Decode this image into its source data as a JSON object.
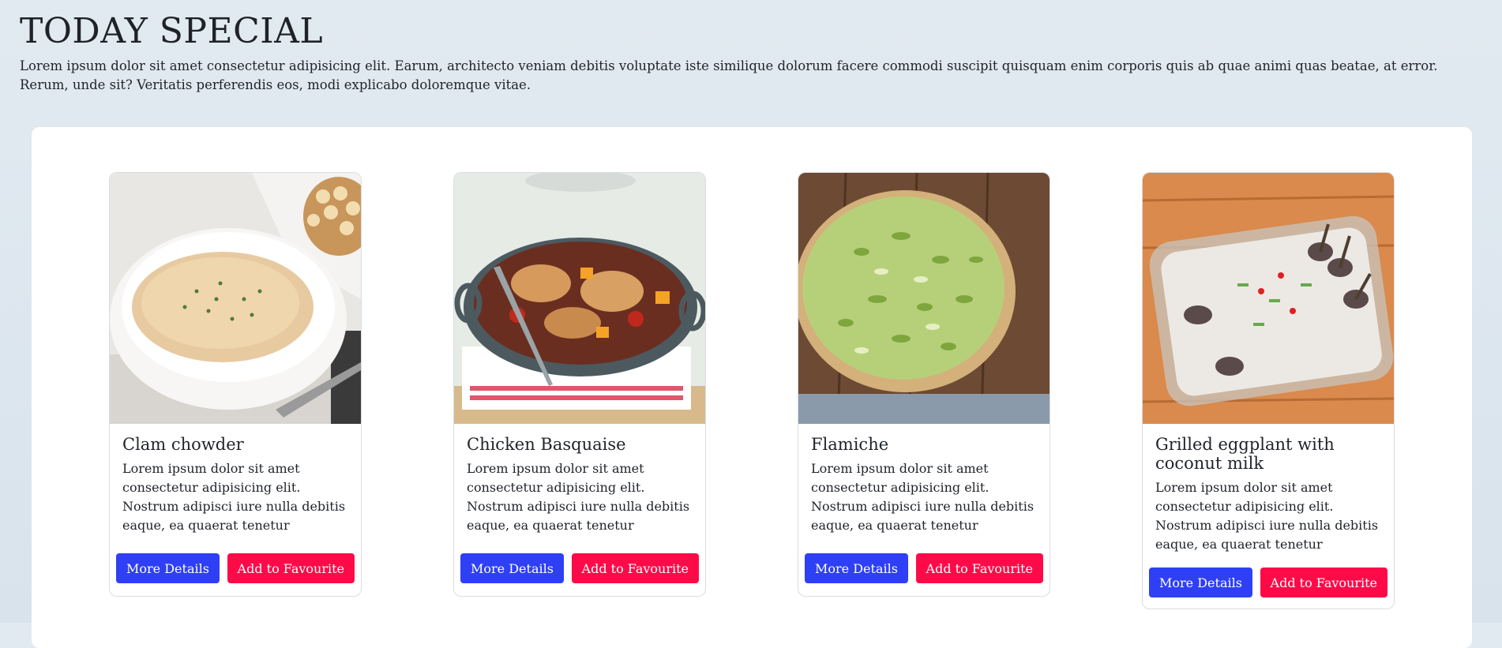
{
  "header": {
    "title": "TODAY SPECIAL",
    "intro": "Lorem ipsum dolor sit amet consectetur adipisicing elit. Earum, architecto veniam debitis voluptate iste similique dolorum facere commodi suscipit quisquam enim corporis quis ab quae animi quas beatae, at error. Rerum, unde sit? Veritatis perferendis eos, modi explicabo doloremque vitae."
  },
  "cards": [
    {
      "title": "Clam chowder",
      "text": "Lorem ipsum dolor sit amet consectetur adipisicing elit. Nostrum adipisci iure nulla debitis eaque, ea quaerat tenetur",
      "details_label": "More Details",
      "favourite_label": "Add to Favourite"
    },
    {
      "title": "Chicken Basquaise",
      "text": "Lorem ipsum dolor sit amet consectetur adipisicing elit. Nostrum adipisci iure nulla debitis eaque, ea quaerat tenetur",
      "details_label": "More Details",
      "favourite_label": "Add to Favourite"
    },
    {
      "title": "Flamiche",
      "text": "Lorem ipsum dolor sit amet consectetur adipisicing elit. Nostrum adipisci iure nulla debitis eaque, ea quaerat tenetur",
      "details_label": "More Details",
      "favourite_label": "Add to Favourite"
    },
    {
      "title": "Grilled eggplant with coconut milk",
      "text": "Lorem ipsum dolor sit amet consectetur adipisicing elit. Nostrum adipisci iure nulla debitis eaque, ea quaerat tenetur",
      "details_label": "More Details",
      "favourite_label": "Add to Favourite"
    }
  ],
  "colors": {
    "primary_button": "#2e3ff5",
    "danger_button": "#ff0a48",
    "background": "#dfe8ef"
  }
}
